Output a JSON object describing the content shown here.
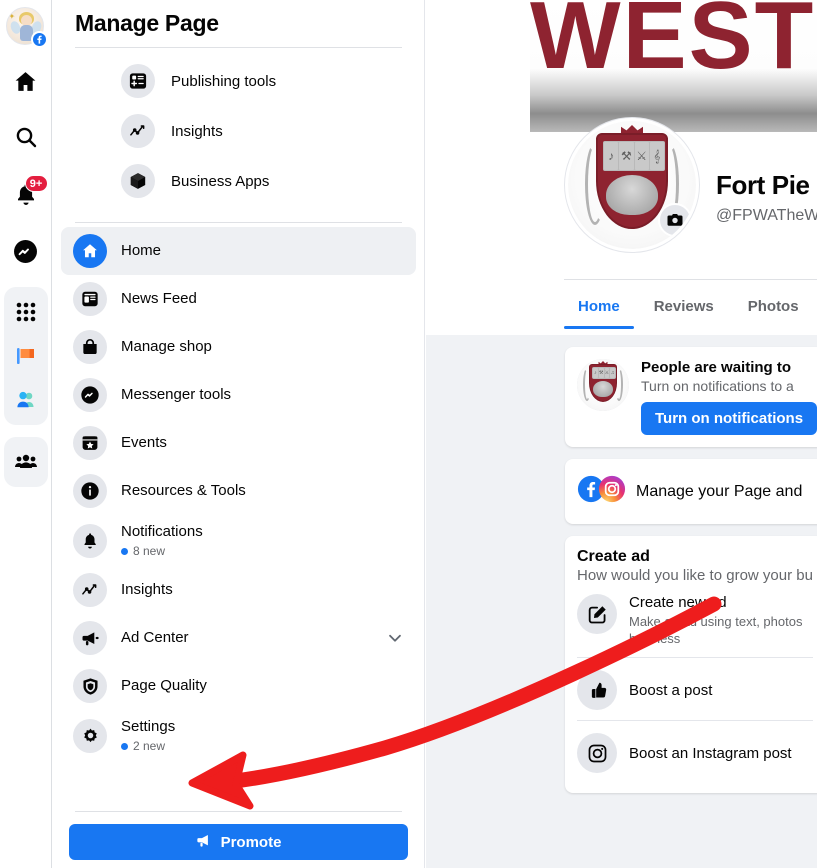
{
  "colors": {
    "fb_blue": "#1877f2",
    "badge_red": "#e41e3f",
    "annotation_red": "#ee1d1d",
    "crest_maroon": "#8e2330",
    "bg_grey": "#f0f2f5",
    "text_secondary": "#65676b"
  },
  "rail": {
    "avatar_name": "user-avatar",
    "notifications_badge": "9+",
    "items": [
      {
        "name": "home-icon",
        "label": "Home"
      },
      {
        "name": "search-icon",
        "label": "Search"
      },
      {
        "name": "notifications-bell-icon",
        "label": "Notifications"
      },
      {
        "name": "messenger-icon",
        "label": "Messenger"
      },
      {
        "name": "menu-grid-icon",
        "label": "Menu"
      },
      {
        "name": "pages-flag-icon",
        "label": "Pages"
      },
      {
        "name": "friends-icon",
        "label": "Friends"
      },
      {
        "name": "groups-icon",
        "label": "Groups"
      }
    ]
  },
  "panel": {
    "title": "Manage Page",
    "quick_links": [
      {
        "label": "Publishing tools",
        "icon": "publishing-tools-icon"
      },
      {
        "label": "Insights",
        "icon": "insights-chart-icon"
      },
      {
        "label": "Business Apps",
        "icon": "business-apps-cube-icon"
      }
    ],
    "nav": [
      {
        "label": "Home",
        "icon": "home-icon",
        "active": true
      },
      {
        "label": "News Feed",
        "icon": "news-feed-icon"
      },
      {
        "label": "Manage shop",
        "icon": "shop-bag-icon"
      },
      {
        "label": "Messenger tools",
        "icon": "messenger-icon"
      },
      {
        "label": "Events",
        "icon": "events-calendar-icon"
      },
      {
        "label": "Resources & Tools",
        "icon": "info-icon"
      },
      {
        "label": "Notifications",
        "icon": "bell-icon",
        "sub": "8 new"
      },
      {
        "label": "Insights",
        "icon": "insights-chart-icon"
      },
      {
        "label": "Ad Center",
        "icon": "megaphone-icon",
        "chevron": true
      },
      {
        "label": "Page Quality",
        "icon": "shield-icon"
      },
      {
        "label": "Settings",
        "icon": "gear-icon",
        "sub": "2 new"
      }
    ],
    "promote_label": "Promote"
  },
  "profile": {
    "cover_text": "WEST",
    "page_name": "Fort Pie",
    "page_handle": "@FPWATheW",
    "tabs": [
      {
        "label": "Home",
        "active": true
      },
      {
        "label": "Reviews",
        "active": false
      },
      {
        "label": "Photos",
        "active": false
      }
    ]
  },
  "feed": {
    "notification_card": {
      "title": "People are waiting to",
      "subtitle": "Turn on notifications to a",
      "button": "Turn on notifications"
    },
    "manage_card": {
      "text": "Manage your Page and",
      "icons": [
        "facebook-icon",
        "instagram-icon"
      ]
    },
    "create_ad_card": {
      "title": "Create ad",
      "subtitle": "How would you like to grow your bu",
      "items": [
        {
          "name": "Create new ad",
          "desc_line1": "Make an ad using text, photos",
          "desc_line2": "business",
          "icon": "compose-ad-icon"
        },
        {
          "name": "Boost a post",
          "icon": "thumbs-up-icon"
        },
        {
          "name": "Boost an Instagram post",
          "icon": "instagram-icon"
        }
      ]
    }
  },
  "annotation": {
    "type": "red-arrow",
    "points_to": "Settings",
    "color": "#ee1d1d"
  }
}
